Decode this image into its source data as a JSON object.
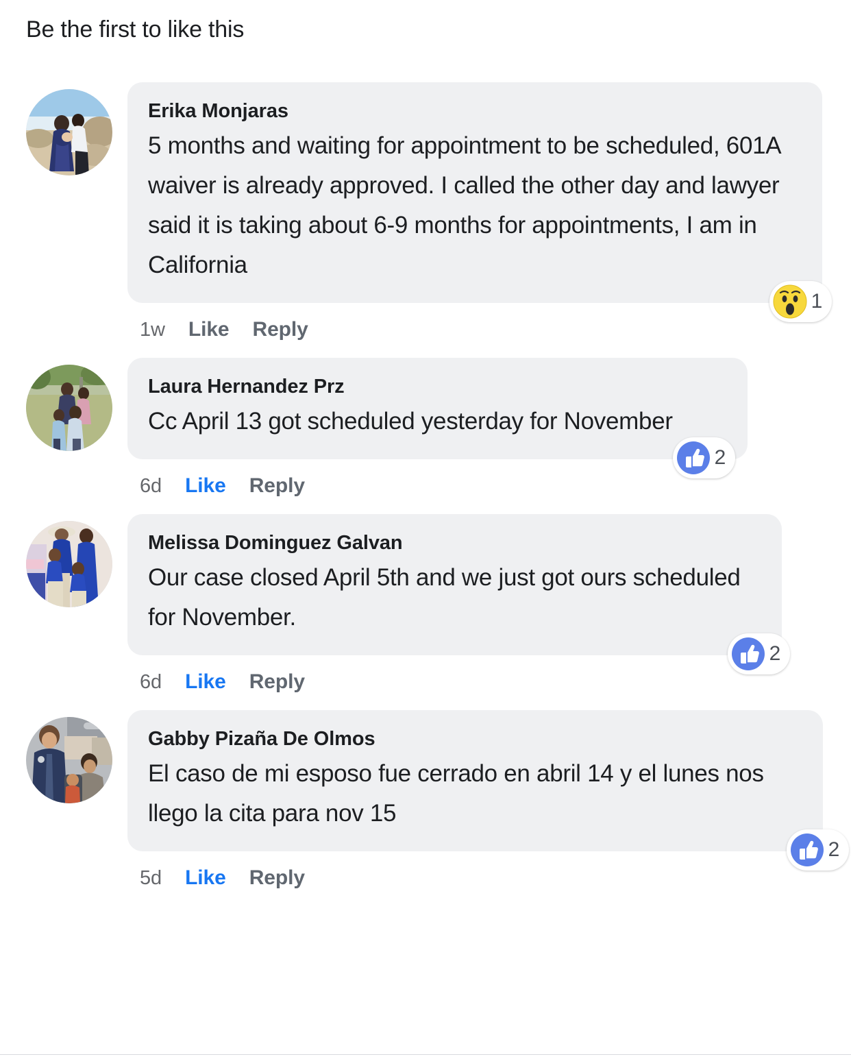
{
  "header": {
    "like_prompt": "Be the first to like this"
  },
  "colors": {
    "bubble_bg": "#eff0f2",
    "text_primary": "#1c1e21",
    "text_secondary": "#65676b",
    "action_gray": "#606770",
    "link_blue": "#1877f2",
    "reaction_blue": "#5b7fe8",
    "reaction_yellow": "#f7d83c",
    "divider": "#d8dadf",
    "page_bg": "#ffffff"
  },
  "comments": [
    {
      "author": "Erika Monjaras",
      "text": "5 months and waiting for appointment to be scheduled, 601A waiver is already approved. I called the other day and lawyer said it is taking about 6-9 months for appointments, I am in California",
      "timestamp": "1w",
      "like_label": "Like",
      "reply_label": "Reply",
      "liked": false,
      "reaction": {
        "type": "wow",
        "icon_name": "wow-reaction-icon",
        "count": "1"
      },
      "avatar_name": "avatar-erika-monjaras",
      "avatar_desc": "couple on beach"
    },
    {
      "author": "Laura Hernandez Prz",
      "text": "Cc April 13 got scheduled yesterday for November",
      "timestamp": "6d",
      "like_label": "Like",
      "reply_label": "Reply",
      "liked": true,
      "reaction": {
        "type": "like",
        "icon_name": "thumbs-up-reaction-icon",
        "count": "2"
      },
      "avatar_name": "avatar-laura-hernandez-prz",
      "avatar_desc": "family on grass with trees"
    },
    {
      "author": "Melissa Dominguez Galvan",
      "text": "Our case closed April 5th and we just got ours scheduled for November.",
      "timestamp": "6d",
      "like_label": "Like",
      "reply_label": "Reply",
      "liked": true,
      "reaction": {
        "type": "like",
        "icon_name": "thumbs-up-reaction-icon",
        "count": "2"
      },
      "avatar_name": "avatar-melissa-dominguez-galvan",
      "avatar_desc": "family in blue shirts, man in cowboy hat"
    },
    {
      "author": "Gabby Pizaña De Olmos",
      "text": "El caso de mi esposo fue cerrado en abril 14 y el lunes nos llego la cita para nov 15",
      "timestamp": "5d",
      "like_label": "Like",
      "reply_label": "Reply",
      "liked": true,
      "reaction": {
        "type": "like",
        "icon_name": "thumbs-up-reaction-icon",
        "count": "2"
      },
      "avatar_name": "avatar-gabby-pizana-de-olmos",
      "avatar_desc": "mother and children inside car"
    }
  ]
}
